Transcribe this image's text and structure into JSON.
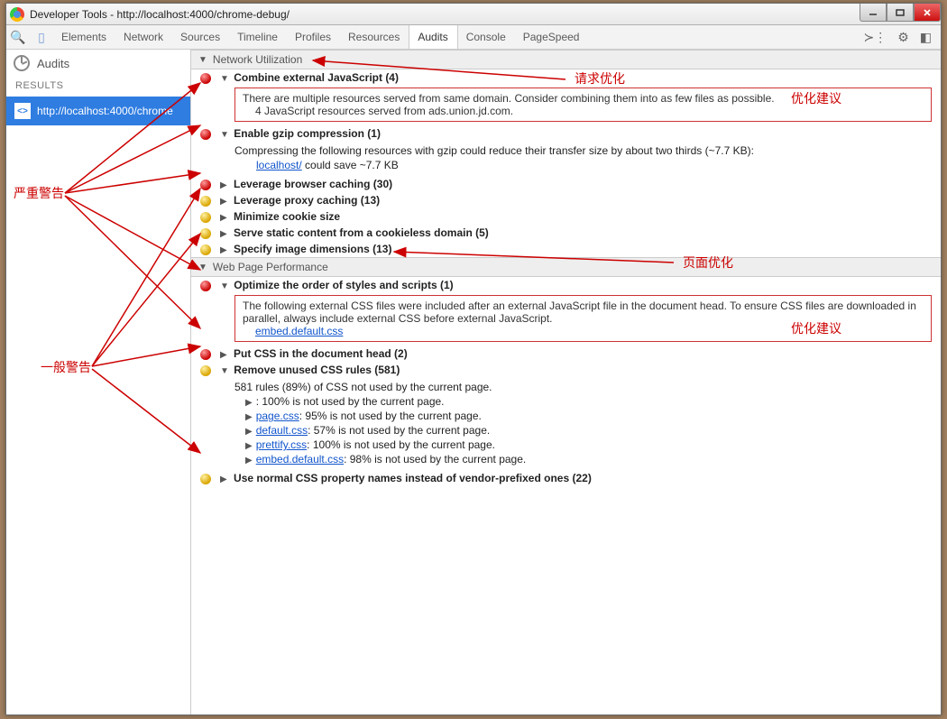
{
  "window": {
    "title": "Developer Tools - http://localhost:4000/chrome-debug/"
  },
  "toolbar": {
    "tabs": [
      "Elements",
      "Network",
      "Sources",
      "Timeline",
      "Profiles",
      "Resources",
      "Audits",
      "Console",
      "PageSpeed"
    ],
    "active": "Audits"
  },
  "sidebar": {
    "header": "Audits",
    "subheader": "RESULTS",
    "item": "http://localhost:4000/chrome"
  },
  "sections": {
    "net": {
      "title": "Network Utilization",
      "items": {
        "combine": {
          "label": "Combine external JavaScript (4)",
          "detail1": "There are multiple resources served from same domain. Consider combining them into as few files as possible.",
          "detail2": "4 JavaScript resources served from ads.union.jd.com."
        },
        "gzip": {
          "label": "Enable gzip compression (1)",
          "detail1": "Compressing the following resources with gzip could reduce their transfer size by about two thirds (~7.7 KB):",
          "link": "localhost/",
          "tail": " could save ~7.7 KB"
        },
        "leverage": {
          "label": "Leverage browser caching (30)"
        },
        "proxy": {
          "label": "Leverage proxy caching (13)"
        },
        "cookie": {
          "label": "Minimize cookie size"
        },
        "static": {
          "label": "Serve static content from a cookieless domain (5)"
        },
        "imgdim": {
          "label": "Specify image dimensions (13)"
        }
      }
    },
    "wpp": {
      "title": "Web Page Performance",
      "items": {
        "order": {
          "label": "Optimize the order of styles and scripts (1)",
          "detail": "The following external CSS files were included after an external JavaScript file in the document head. To ensure CSS files are downloaded in parallel, always include external CSS before external JavaScript.",
          "link": "embed.default.css"
        },
        "putcss": {
          "label": "Put CSS in the document head (2)"
        },
        "unused": {
          "label": "Remove unused CSS rules (581)",
          "sum": "581 rules (89%) of CSS not used by the current page.",
          "rules": [
            {
              "pre": "",
              "link": "",
              "text": ": 100% is not used by the current page."
            },
            {
              "pre": "",
              "link": "page.css",
              "text": ": 95% is not used by the current page."
            },
            {
              "pre": "",
              "link": "default.css",
              "text": ": 57% is not used by the current page."
            },
            {
              "pre": "",
              "link": "prettify.css",
              "text": ": 100% is not used by the current page."
            },
            {
              "pre": "",
              "link": "embed.default.css",
              "text": ": 98% is not used by the current page."
            }
          ]
        },
        "vendor": {
          "label": "Use normal CSS property names instead of vendor-prefixed ones (22)"
        }
      }
    }
  },
  "annotations": {
    "req_opt": "请求优化",
    "opt_suggest": "优化建议",
    "page_opt": "页面优化",
    "severe": "严重警告",
    "general": "一般警告"
  }
}
